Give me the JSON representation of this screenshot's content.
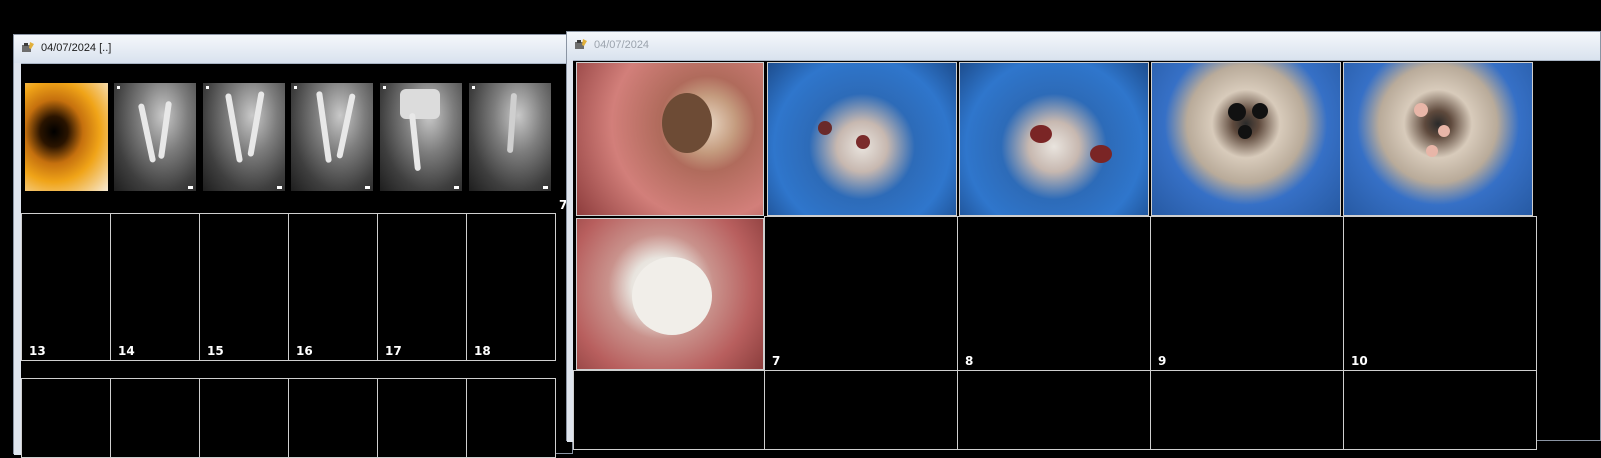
{
  "window1": {
    "title": "04/07/2024 [..]"
  },
  "window2": {
    "title": "04/07/2024"
  },
  "window1_thumbs": [
    {
      "kind": "orange-xray"
    },
    {
      "kind": "xray"
    },
    {
      "kind": "xray"
    },
    {
      "kind": "xray"
    },
    {
      "kind": "xray"
    },
    {
      "kind": "xray"
    }
  ],
  "window1_partial_label": "7",
  "window1_slots_row2": [
    "13",
    "14",
    "15",
    "16",
    "17",
    "18"
  ],
  "window2_photos": [
    "photo-gum",
    "photo-dam",
    "photo-dam",
    "photo-canal",
    "photo-canal",
    "photo-crown"
  ],
  "window2_slots_row2": [
    "7",
    "8",
    "9",
    "10"
  ],
  "icons": {
    "title_icon": "camera-wrench-icon"
  },
  "colors": {
    "background": "#000000",
    "titlebar": "#dbe4ef",
    "grid_line": "#cfcfcf"
  }
}
